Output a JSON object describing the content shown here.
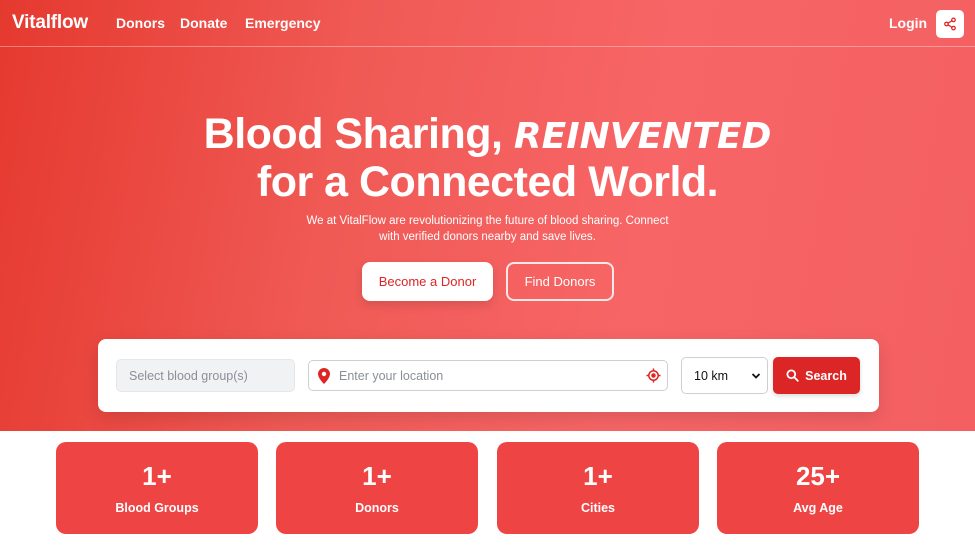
{
  "nav": {
    "brand": "Vitalflow",
    "links": [
      "Donors",
      "Donate",
      "Emergency"
    ],
    "login": "Login",
    "share_icon": "share-icon"
  },
  "hero": {
    "headline_part1": "Blood Sharing,",
    "headline_accent": "Reinvented",
    "headline_line2": "for a Connected World.",
    "subtext": "We at VitalFlow are revolutionizing the future of blood sharing. Connect with verified donors nearby and save lives.",
    "primary_button": "Become a Donor",
    "secondary_button": "Find Donors"
  },
  "search": {
    "blood_group_placeholder": "Select blood group(s)",
    "location_placeholder": "Enter your location",
    "radius_selected": "10 km",
    "search_button": "Search",
    "icons": [
      "map-pin-icon",
      "crosshair-icon",
      "chevron-down-icon",
      "search-icon"
    ]
  },
  "stats": [
    {
      "value": "1+",
      "label": "Blood Groups"
    },
    {
      "value": "1+",
      "label": "Donors"
    },
    {
      "value": "1+",
      "label": "Cities"
    },
    {
      "value": "25+",
      "label": "Avg Age"
    }
  ],
  "colors": {
    "brand_red": "#dc2626",
    "stat_card": "#ef4444",
    "hero_gradient_start": "#e5392f",
    "hero_gradient_end": "#f76566"
  }
}
